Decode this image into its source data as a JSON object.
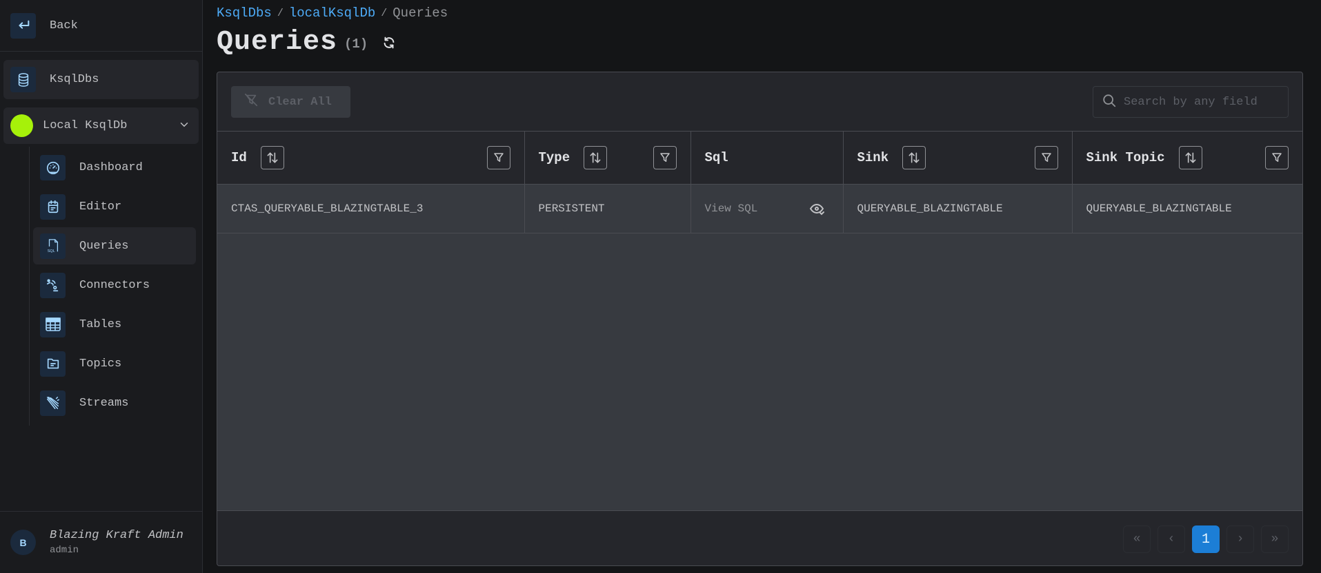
{
  "sidebar": {
    "back_label": "Back",
    "ksqldbs_label": "KsqlDbs",
    "cluster": {
      "name": "Local KsqlDb",
      "color": "#a6f10a"
    },
    "items": [
      {
        "label": "Dashboard",
        "icon": "dashboard-gauge-icon"
      },
      {
        "label": "Editor",
        "icon": "editor-calendar-icon"
      },
      {
        "label": "Queries",
        "icon": "sql-file-icon",
        "active": true
      },
      {
        "label": "Connectors",
        "icon": "connectors-icon"
      },
      {
        "label": "Tables",
        "icon": "table-icon"
      },
      {
        "label": "Topics",
        "icon": "folder-icon"
      },
      {
        "label": "Streams",
        "icon": "streams-icon"
      }
    ],
    "user": {
      "initial": "B",
      "name": "Blazing Kraft Admin",
      "role": "admin"
    }
  },
  "breadcrumb": [
    {
      "label": "KsqlDbs",
      "link": true
    },
    {
      "label": "localKsqlDb",
      "link": true
    },
    {
      "label": "Queries",
      "link": false
    }
  ],
  "breadcrumb_sep": "/",
  "page": {
    "title": "Queries",
    "count": "(1)"
  },
  "toolbar": {
    "clear_all_label": "Clear All",
    "search_placeholder": "Search by any field",
    "search_value": ""
  },
  "table": {
    "columns": [
      {
        "label": "Id",
        "sortable": true,
        "filterable": true
      },
      {
        "label": "Type",
        "sortable": true,
        "filterable": true
      },
      {
        "label": "Sql",
        "sortable": false,
        "filterable": false
      },
      {
        "label": "Sink",
        "sortable": true,
        "filterable": true
      },
      {
        "label": "Sink Topic",
        "sortable": true,
        "filterable": true
      }
    ],
    "rows": [
      {
        "id": "CTAS_QUERYABLE_BLAZINGTABLE_3",
        "type": "PERSISTENT",
        "sql": "View SQL",
        "sink": "QUERYABLE_BLAZINGTABLE",
        "sink_topic": "QUERYABLE_BLAZINGTABLE"
      }
    ]
  },
  "pagination": {
    "first": "«",
    "prev": "‹",
    "current": "1",
    "next": "›",
    "last": "»"
  },
  "colors": {
    "accent": "#1c7ed6",
    "link": "#4dabf7",
    "icon_bg": "#1b2a3d"
  }
}
